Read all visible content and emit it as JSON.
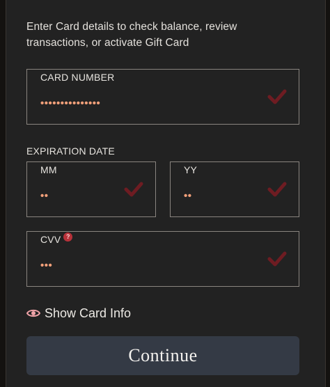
{
  "intro_text": "Enter Card details to check balance, review transactions, or activate Gift Card",
  "card_number": {
    "label": "CARD NUMBER",
    "value": "•••••••••••••••"
  },
  "expiration": {
    "label": "EXPIRATION DATE",
    "month": {
      "label": "MM",
      "value": "••"
    },
    "year": {
      "label": "YY",
      "value": "••"
    }
  },
  "cvv": {
    "label": "CVV",
    "help_glyph": "?",
    "value": "•••"
  },
  "show_card_info": {
    "label": "Show Card Info",
    "icon": "eye-icon"
  },
  "continue_button": {
    "label": "Continue"
  },
  "colors": {
    "background": "#222222",
    "masked_value": "#f2a07a",
    "check": "#6e1c22",
    "button": "#343a45",
    "eye_icon": "#f0a3a8",
    "help_badge": "#b8323a"
  }
}
